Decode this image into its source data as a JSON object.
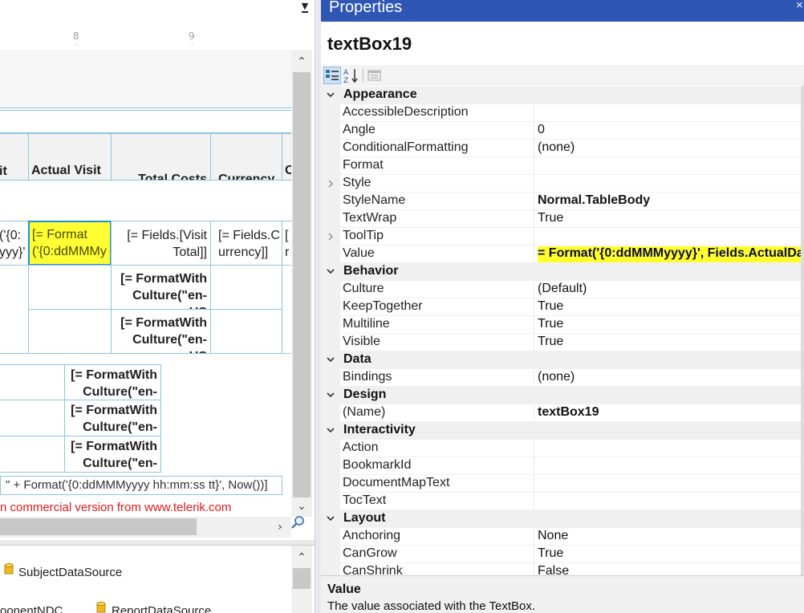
{
  "designer": {
    "ruler": {
      "ticks": [
        "8",
        "9"
      ]
    },
    "table": {
      "headers": {
        "partial": "it",
        "actual_visit_date": "Actual Visit Date",
        "total_costs": "Total Costs",
        "currency": "Currency",
        "partial_right": "C V"
      },
      "body_row": {
        "partial": "('{0: yyy}'",
        "actual_visit_date": "[= Format('{0:ddMMMyy",
        "total_costs": "[= Fields.[Visit Total]]",
        "currency": "[= Fields.Currency]]",
        "partial_right": "[ r"
      },
      "format_with_culture": "[= FormatWith Culture(\"en-US"
    },
    "expression_footer": "\" + Format('{0:ddMMMyyyy hh:mm:ss tt}', Now())]",
    "trial_notice": "n commercial version from www.telerik.com",
    "datasources": [
      "SubjectDataSource",
      "oonentNDC",
      "ReportDataSource"
    ]
  },
  "properties": {
    "title": "Properties",
    "object_name": "textBox19",
    "categories": [
      {
        "name": "Appearance",
        "rows": [
          {
            "name": "AccessibleDescription",
            "value": ""
          },
          {
            "name": "Angle",
            "value": "0"
          },
          {
            "name": "ConditionalFormatting",
            "value": "(none)"
          },
          {
            "name": "Format",
            "value": ""
          },
          {
            "name": "Style",
            "value": ""
          },
          {
            "name": "StyleName",
            "value": "Normal.TableBody"
          },
          {
            "name": "TextWrap",
            "value": "True"
          },
          {
            "name": "ToolTip",
            "value": ""
          },
          {
            "name": "Value",
            "value": "= Format('{0:ddMMMyyyy}', Fields.ActualDa"
          }
        ]
      },
      {
        "name": "Behavior",
        "rows": [
          {
            "name": "Culture",
            "value": "(Default)"
          },
          {
            "name": "KeepTogether",
            "value": "True"
          },
          {
            "name": "Multiline",
            "value": "True"
          },
          {
            "name": "Visible",
            "value": "True"
          }
        ]
      },
      {
        "name": "Data",
        "rows": [
          {
            "name": "Bindings",
            "value": "(none)"
          }
        ]
      },
      {
        "name": "Design",
        "rows": [
          {
            "name": "(Name)",
            "value": "textBox19"
          }
        ]
      },
      {
        "name": "Interactivity",
        "rows": [
          {
            "name": "Action",
            "value": ""
          },
          {
            "name": "BookmarkId",
            "value": ""
          },
          {
            "name": "DocumentMapText",
            "value": ""
          },
          {
            "name": "TocText",
            "value": ""
          }
        ]
      },
      {
        "name": "Layout",
        "rows": [
          {
            "name": "Anchoring",
            "value": "None"
          },
          {
            "name": "CanGrow",
            "value": "True"
          },
          {
            "name": "CanShrink",
            "value": "False"
          }
        ]
      }
    ],
    "description": {
      "title": "Value",
      "text": "The value associated with the TextBox."
    }
  },
  "colors": {
    "title_bar": "#2e57b5",
    "highlight": "#ffff2a",
    "selection_border": "#1b8fe0",
    "trial_red": "#e01a1a",
    "grid_line": "#8fc4dd"
  },
  "icons": {
    "categorized": "categorized-view-icon",
    "alphabetical": "sort-az-icon",
    "property_pages": "property-pages-icon",
    "datasource": "database-icon",
    "zoom": "magnifier-icon"
  }
}
